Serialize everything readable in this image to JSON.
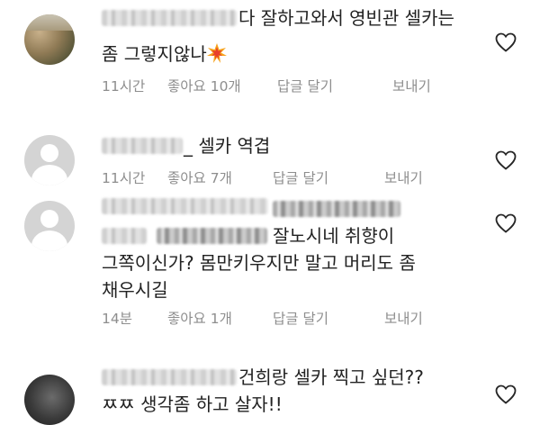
{
  "comments": [
    {
      "text_line1": "다 잘하고와서 영빈관 셀카는",
      "text_line2": "좀 그렇지않나",
      "emoji": "collision-emoji",
      "time": "11시간",
      "likes": "좋아요 10개",
      "reply": "답글 달기",
      "send": "보내기"
    },
    {
      "text_line1": "_ 셀카 역겹",
      "time": "11시간",
      "likes": "좋아요 7개",
      "reply": "답글 달기",
      "send": "보내기"
    },
    {
      "text_line1": "잘노시네 취향이",
      "text_line2": "그쪽이신가? 몸만키우지만 말고 머리도 좀",
      "text_line3": "채우시길",
      "time": "14분",
      "likes": "좋아요 1개",
      "reply": "답글 달기",
      "send": "보내기"
    },
    {
      "text_line1": "건희랑 셀카 찍고 싶던??",
      "text_line2": "ㅉㅉ 생각좀 하고 살자!!"
    }
  ],
  "icons": {
    "like": "heart-outline-icon",
    "default_avatar": "default-user-avatar-icon"
  },
  "colors": {
    "meta_text": "#8e8e8e",
    "body_text": "#222222",
    "heart_stroke": "#262626"
  }
}
